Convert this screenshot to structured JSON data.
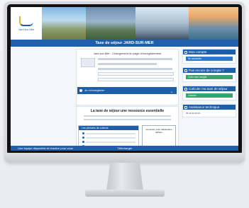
{
  "site": {
    "logo_text": "Jard sur Mer",
    "page_title": "Taxe de séjour JARD-SUR-MER"
  },
  "center_card": {
    "title": "Jard-sur-Mer - Changement du page d'enregistrement",
    "accordion_label": "Je m'enregistrer"
  },
  "info_section": {
    "title": "La taxe de séjour une ressource essentielle",
    "box_title": "Les périodes de collecte",
    "callout": "Consultez votre délibération tarifaire"
  },
  "sidebar": {
    "account": {
      "title": "Mon compte",
      "button": "Se connecter"
    },
    "register": {
      "title": "Pas encore de compte ?",
      "button": "Créer mon compte"
    },
    "calculate": {
      "title": "Calculer ma taxe de séjour",
      "button": "Calculer"
    },
    "support": {
      "title": "Assistance technique",
      "text": "05 40 33 29 29"
    }
  },
  "bottom": {
    "left_label": "Une équipe disponible et réactive pour vous",
    "right_label": "Télécharger"
  },
  "colors": {
    "brand_blue": "#1f5fa9",
    "success_green": "#3aa26c"
  }
}
